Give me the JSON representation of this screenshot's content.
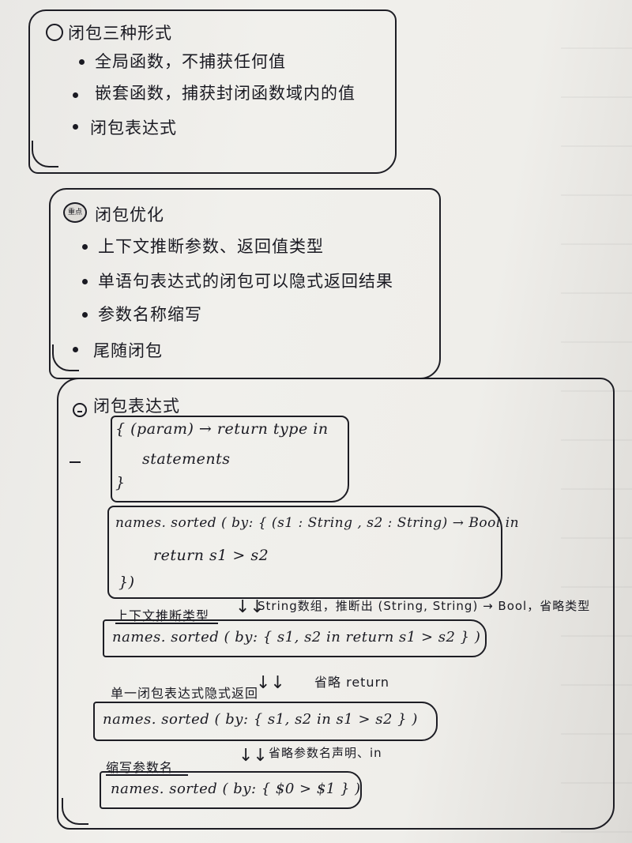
{
  "section1": {
    "title": "闭包三种形式",
    "items": [
      "全局函数，不捕获任何值",
      "嵌套函数，捕获封闭函数域内的值",
      "闭包表达式"
    ]
  },
  "section2": {
    "marker": "重点",
    "title": "闭包优化",
    "items": [
      "上下文推断参数、返回值类型",
      "单语句表达式的闭包可以隐式返回结果",
      "参数名称缩写",
      "尾随闭包"
    ]
  },
  "section3": {
    "title": "闭包表达式",
    "syntax": {
      "line1": "{ (param) → return type  in",
      "line2": "statements",
      "line3": "}"
    },
    "example_full": {
      "line1": "names. sorted ( by: { (s1 : String , s2 : String) → Bool  in",
      "line2": "return  s1 > s2",
      "line3": "})"
    },
    "step1_label": "上下文推断类型",
    "step1_note": "String数组，推断出 (String, String) → Bool，省略类型",
    "step1_code": "names. sorted ( by: { s1, s2  in  return  s1 > s2 } )",
    "step2_label": "单一闭包表达式隐式返回",
    "step2_note": "省略 return",
    "step2_code": "names. sorted ( by: { s1, s2  in   s1 > s2 } )",
    "step3_label": "缩写参数名",
    "step3_note": "省略参数名声明、in",
    "step3_code": "names. sorted ( by:  { $0 > $1 } )"
  },
  "arrow_glyph": "↓↓"
}
